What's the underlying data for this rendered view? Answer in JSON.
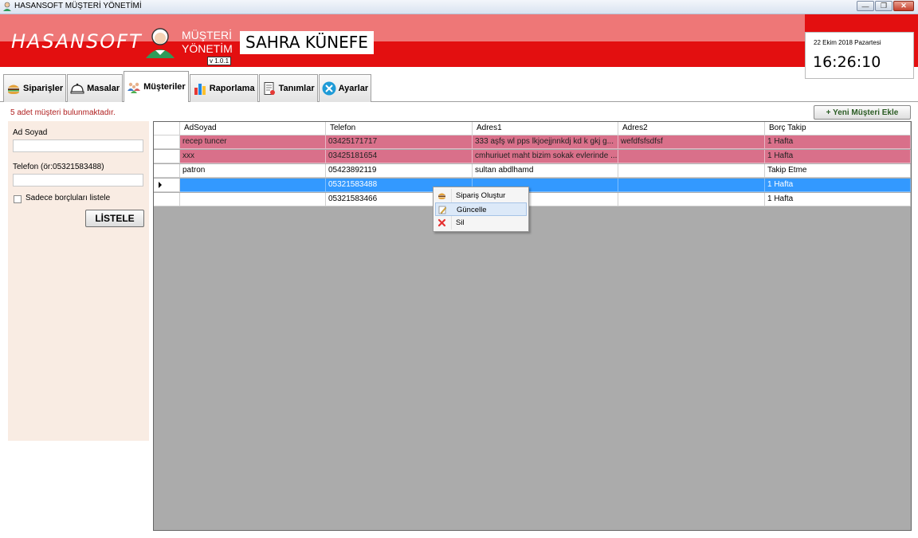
{
  "window": {
    "title": "HASANSOFT MÜŞTERİ YÖNETİMİ",
    "buttons": [
      "minimize",
      "restore",
      "close"
    ]
  },
  "header": {
    "brand": "HASANSOFT",
    "product_line1": "MÜŞTERİ",
    "product_line2": "YÖNETİM",
    "version": "v 1.0.1",
    "company": "SAHRA KÜNEFE",
    "date": "22 Ekim 2018 Pazartesi",
    "time": "16:26:10"
  },
  "tabs": [
    {
      "label": "Siparişler",
      "icon": "burger-icon"
    },
    {
      "label": "Masalar",
      "icon": "service-bell-icon"
    },
    {
      "label": "Müşteriler",
      "icon": "people-icon",
      "active": true
    },
    {
      "label": "Raporlama",
      "icon": "bar-chart-icon"
    },
    {
      "label": "Tanımlar",
      "icon": "document-icon"
    },
    {
      "label": "Ayarlar",
      "icon": "tools-icon"
    }
  ],
  "status": {
    "count_text": "5 adet müşteri bulunmaktadır."
  },
  "toolbar": {
    "add_customer_label": "+ Yeni Müşteri Ekle"
  },
  "filter": {
    "name_label": "Ad Soyad",
    "name_value": "",
    "phone_label": "Telefon (ör:05321583488)",
    "phone_value": "",
    "debt_only_label": "Sadece borçluları listele",
    "debt_only_checked": false,
    "list_button": "LİSTELE"
  },
  "grid": {
    "columns": [
      "AdSoyad",
      "Telefon",
      "Adres1",
      "Adres2",
      "Borç Takip"
    ],
    "rows": [
      {
        "cells": [
          "recep tuncer",
          "03425171717",
          "333 aşfş wl pps lkjoejjnnkdj kd k  gkj g...",
          "wefdfsfsdfsf",
          "1 Hafta"
        ],
        "style": "pink"
      },
      {
        "cells": [
          "xxx",
          "03425181654",
          "cmhuriuet maht bizim sokak evlerinde ...",
          "",
          "1 Hafta"
        ],
        "style": "pink"
      },
      {
        "cells": [
          "patron",
          "05423892119",
          "sultan abdlhamd",
          "",
          "Takip Etme"
        ],
        "style": "white"
      },
      {
        "cells": [
          "",
          "05321583488",
          "",
          "",
          "1 Hafta"
        ],
        "style": "sel"
      },
      {
        "cells": [
          "",
          "05321583466",
          "",
          "",
          "1 Hafta"
        ],
        "style": "white"
      }
    ]
  },
  "context_menu": {
    "items": [
      {
        "label": "Sipariş Oluştur",
        "icon": "burger-icon"
      },
      {
        "label": "Güncelle",
        "icon": "edit-icon",
        "highlighted": true
      },
      {
        "label": "Sil",
        "icon": "delete-icon"
      }
    ]
  },
  "colors": {
    "header_red": "#e30f10",
    "header_pink": "#ee7777",
    "row_pink": "#d9708a",
    "row_selected": "#3399ff",
    "panel_bg": "#f9ece3",
    "grid_bg": "#ababab"
  }
}
